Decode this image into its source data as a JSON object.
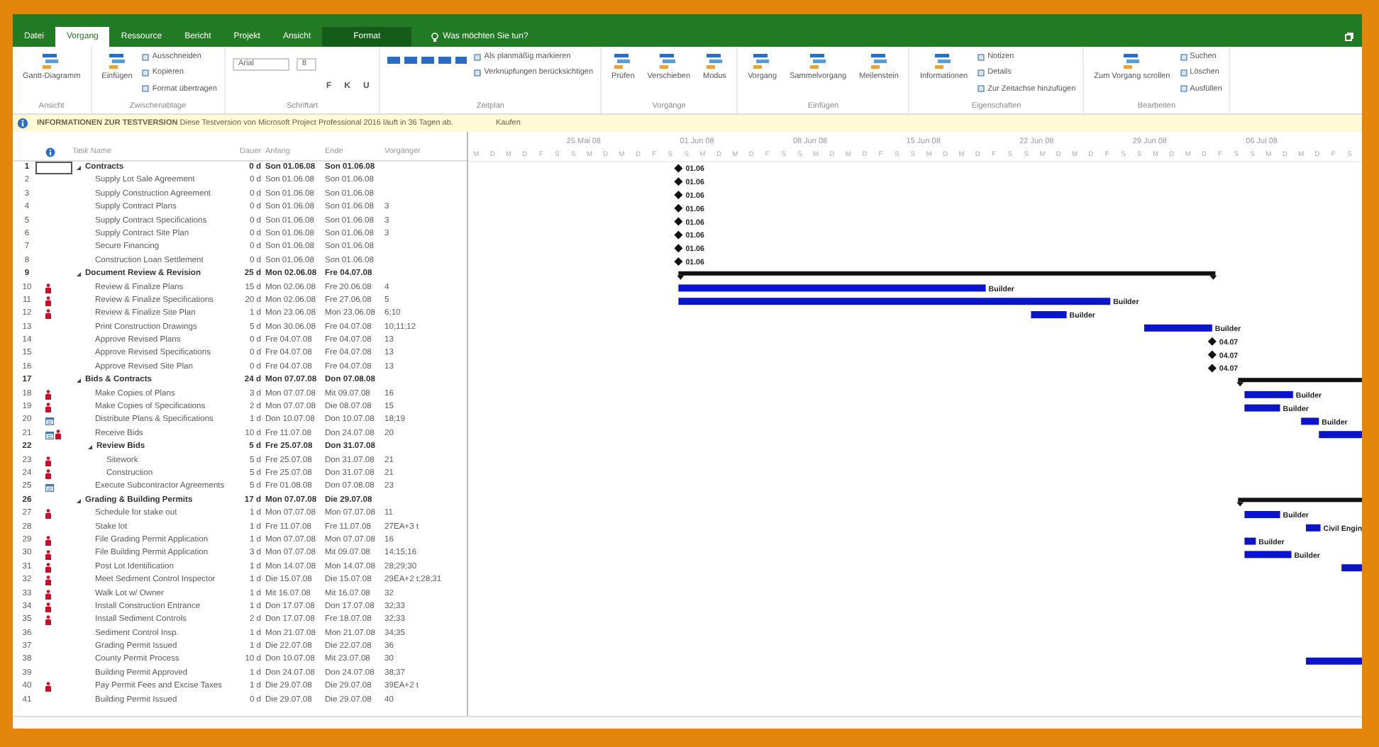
{
  "tabs": [
    {
      "label": "Datei",
      "kind": "tab",
      "selected": false
    },
    {
      "label": "Vorgang",
      "kind": "tab",
      "selected": true
    },
    {
      "label": "Ressource",
      "kind": "tab",
      "selected": false
    },
    {
      "label": "Bericht",
      "kind": "tab",
      "selected": false
    },
    {
      "label": "Projekt",
      "kind": "tab",
      "selected": false
    },
    {
      "label": "Ansicht",
      "kind": "tab",
      "selected": false
    },
    {
      "label": "Format",
      "kind": "contextual",
      "selected": false
    },
    {
      "label": "Was möchten Sie tun?",
      "kind": "search",
      "selected": false
    }
  ],
  "ribbon": {
    "groups": [
      {
        "label": "Ansicht",
        "items": [
          {
            "kind": "large",
            "label": "Gantt-Diagramm"
          }
        ]
      },
      {
        "label": "Zwischenablage",
        "items": [
          {
            "kind": "large",
            "label": "Einfügen"
          },
          {
            "kind": "small",
            "label": "Ausschneiden"
          },
          {
            "kind": "small",
            "label": "Kopieren"
          },
          {
            "kind": "small",
            "label": "Format übertragen"
          }
        ]
      },
      {
        "label": "Schriftart",
        "items": [
          {
            "kind": "combo",
            "value": "Arial"
          },
          {
            "kind": "combo",
            "value": "8"
          },
          {
            "kind": "toggle",
            "label": "F"
          },
          {
            "kind": "toggle",
            "label": "K"
          },
          {
            "kind": "toggle",
            "label": "U"
          }
        ]
      },
      {
        "label": "Zeitplan",
        "items": [
          {
            "kind": "percent"
          },
          {
            "kind": "small",
            "label": "Als planmäßig markieren"
          },
          {
            "kind": "small",
            "label": "Verknüpfungen berücksichtigen"
          }
        ]
      },
      {
        "label": "Vorgänge",
        "items": [
          {
            "kind": "large",
            "label": "Prüfen"
          },
          {
            "kind": "large",
            "label": "Verschieben"
          },
          {
            "kind": "large",
            "label": "Modus"
          }
        ]
      },
      {
        "label": "Einfügen",
        "items": [
          {
            "kind": "large",
            "label": "Vorgang"
          },
          {
            "kind": "large",
            "label": "Sammelvorgang"
          },
          {
            "kind": "large",
            "label": "Meilenstein"
          }
        ]
      },
      {
        "label": "Eigenschaften",
        "items": [
          {
            "kind": "large",
            "label": "Informationen"
          },
          {
            "kind": "small",
            "label": "Notizen"
          },
          {
            "kind": "small",
            "label": "Details"
          },
          {
            "kind": "small",
            "label": "Zur Zeitachse hinzufügen"
          }
        ]
      },
      {
        "label": "Bearbeiten",
        "items": [
          {
            "kind": "large",
            "label": "Zum Vorgang scrollen"
          },
          {
            "kind": "small",
            "label": "Suchen"
          },
          {
            "kind": "small",
            "label": "Löschen"
          },
          {
            "kind": "small",
            "label": "Ausfüllen"
          }
        ]
      }
    ]
  },
  "info": {
    "title": "INFORMATIONEN ZUR TESTVERSION",
    "message": "Diese Testversion von Microsoft Project Professional 2016 läuft in 36 Tagen ab.",
    "button": "Kaufen"
  },
  "columns": [
    "Task Name",
    "Dauer",
    "Anfang",
    "Ende",
    "Vorgänger"
  ],
  "timescale": {
    "weeks": [
      "25 Mai 08",
      "01 Jun 08",
      "08 Jun 08",
      "15 Jun 08",
      "22 Jun 08",
      "29 Jun 08",
      "06 Jul 08"
    ],
    "days": [
      "M",
      "D",
      "M",
      "D",
      "F",
      "S",
      "S",
      "M",
      "D",
      "M",
      "D",
      "F",
      "S",
      "S",
      "M",
      "D",
      "M",
      "D",
      "F",
      "S",
      "S",
      "M",
      "D",
      "M",
      "D",
      "F",
      "S",
      "S",
      "M",
      "D",
      "M",
      "D",
      "F",
      "S",
      "S",
      "M",
      "D",
      "M",
      "D",
      "F",
      "S",
      "S",
      "M",
      "D",
      "M",
      "D",
      "F",
      "S",
      "S",
      "M",
      "D",
      "M",
      "D",
      "F",
      "S"
    ]
  },
  "tasks": [
    {
      "id": "1",
      "name": "Contracts",
      "duration": "0 d",
      "start": "Son 01.06.08",
      "finish": "Son 01.06.08",
      "selected": true,
      "expanded": true,
      "bar_label": "01.06",
      "children": [
        {
          "id": "2",
          "name": "Supply Lot Sale Agreement",
          "duration": "0 d",
          "start": "Son 01.06.08",
          "finish": "Son 01.06.08",
          "selected": false,
          "bar_label": "01.06"
        },
        {
          "id": "3",
          "name": "Supply Construction Agreement",
          "duration": "0 d",
          "start": "Son 01.06.08",
          "finish": "Son 01.06.08",
          "selected": false,
          "bar_label": "01.06"
        },
        {
          "id": "4",
          "name": "Supply Contract Plans",
          "duration": "0 d",
          "start": "Son 01.06.08",
          "finish": "Son 01.06.08",
          "predecessors": "3",
          "selected": false,
          "bar_label": "01.06"
        },
        {
          "id": "5",
          "name": "Supply Contract Specifications",
          "duration": "0 d",
          "start": "Son 01.06.08",
          "finish": "Son 01.06.08",
          "predecessors": "3",
          "selected": false,
          "bar_label": "01.06"
        },
        {
          "id": "6",
          "name": "Supply Contract Site Plan",
          "duration": "0 d",
          "start": "Son 01.06.08",
          "finish": "Son 01.06.08",
          "predecessors": "3",
          "selected": false,
          "bar_label": "01.06"
        },
        {
          "id": "7",
          "name": "Secure Financing",
          "duration": "0 d",
          "start": "Son 01.06.08",
          "finish": "Son 01.06.08",
          "selected": false,
          "bar_label": "01.06"
        },
        {
          "id": "8",
          "name": "Construction Loan Settlement",
          "duration": "0 d",
          "start": "Son 01.06.08",
          "finish": "Son 01.06.08",
          "selected": false,
          "bar_label": "01.06"
        }
      ]
    },
    {
      "id": "9",
      "name": "Document Review & Revision",
      "duration": "25 d",
      "start": "Mon 02.06.08",
      "finish": "Fre 04.07.08",
      "selected": false,
      "expanded": true,
      "children": [
        {
          "id": "10",
          "name": "Review & Finalize Plans",
          "duration": "15 d",
          "start": "Mon 02.06.08",
          "finish": "Fre 20.06.08",
          "predecessors": "4",
          "resource": true,
          "selected": false,
          "bar_label": "Builder"
        },
        {
          "id": "11",
          "name": "Review & Finalize Specifications",
          "duration": "20 d",
          "start": "Mon 02.06.08",
          "finish": "Fre 27.06.08",
          "predecessors": "5",
          "resource": true,
          "selected": false,
          "bar_label": "Builder"
        },
        {
          "id": "12",
          "name": "Review & Finalize Site Plan",
          "duration": "1 d",
          "start": "Mon 23.06.08",
          "finish": "Mon 23.06.08",
          "predecessors": "6;10",
          "resource": true,
          "selected": false,
          "bar_label": "Builder"
        },
        {
          "id": "13",
          "name": "Print Construction Drawings",
          "duration": "5 d",
          "start": "Mon 30.06.08",
          "finish": "Fre 04.07.08",
          "predecessors": "10;11;12",
          "selected": false,
          "bar_label": "Builder"
        },
        {
          "id": "14",
          "name": "Approve Revised Plans",
          "duration": "0 d",
          "start": "Fre 04.07.08",
          "finish": "Fre 04.07.08",
          "predecessors": "13",
          "selected": false,
          "bar_label": "04.07"
        },
        {
          "id": "15",
          "name": "Approve Revised Specifications",
          "duration": "0 d",
          "start": "Fre 04.07.08",
          "finish": "Fre 04.07.08",
          "predecessors": "13",
          "selected": false,
          "bar_label": "04.07"
        },
        {
          "id": "16",
          "name": "Approve Revised Site Plan",
          "duration": "0 d",
          "start": "Fre 04.07.08",
          "finish": "Fre 04.07.08",
          "predecessors": "13",
          "selected": false,
          "bar_label": "04.07"
        }
      ]
    },
    {
      "id": "17",
      "name": "Bids & Contracts",
      "duration": "24 d",
      "start": "Mon 07.07.08",
      "finish": "Don 07.08.08",
      "selected": false,
      "expanded": true,
      "children": [
        {
          "id": "18",
          "name": "Make Copies of Plans",
          "duration": "3 d",
          "start": "Mon 07.07.08",
          "finish": "Mit 09.07.08",
          "predecessors": "16",
          "resource": true,
          "selected": false,
          "bar_label": "Builder"
        },
        {
          "id": "19",
          "name": "Make Copies of Specifications",
          "duration": "2 d",
          "start": "Mon 07.07.08",
          "finish": "Die 08.07.08",
          "predecessors": "15",
          "resource": true,
          "selected": false,
          "bar_label": "Builder"
        },
        {
          "id": "20",
          "name": "Distribute Plans & Specifications",
          "duration": "1 d",
          "start": "Don 10.07.08",
          "finish": "Don 10.07.08",
          "predecessors": "18;19",
          "calendar": true,
          "selected": false,
          "bar_label": "Builder"
        },
        {
          "id": "21",
          "name": "Receive Bids",
          "duration": "10 d",
          "start": "Fre 11.07.08",
          "finish": "Don 24.07.08",
          "predecessors": "20",
          "calendar": true,
          "resource": true,
          "selected": false
        },
        {
          "id": "22",
          "name": "Review Bids",
          "duration": "5 d",
          "start": "Fre 25.07.08",
          "finish": "Don 31.07.08",
          "selected": false,
          "expanded": true,
          "children": [
            {
              "id": "23",
              "name": "Sitework",
              "duration": "5 d",
              "start": "Fre 25.07.08",
              "finish": "Don 31.07.08",
              "predecessors": "21",
              "resource": true,
              "selected": false
            },
            {
              "id": "24",
              "name": "Construction",
              "duration": "5 d",
              "start": "Fre 25.07.08",
              "finish": "Don 31.07.08",
              "predecessors": "21",
              "resource": true,
              "selected": false
            }
          ]
        },
        {
          "id": "25",
          "name": "Execute Subcontractor Agreements",
          "duration": "5 d",
          "start": "Fre 01.08.08",
          "finish": "Don 07.08.08",
          "predecessors": "23",
          "calendar": true,
          "selected": false
        }
      ]
    },
    {
      "id": "26",
      "name": "Grading & Building Permits",
      "duration": "17 d",
      "start": "Mon 07.07.08",
      "finish": "Die 29.07.08",
      "selected": false,
      "expanded": true,
      "children": [
        {
          "id": "27",
          "name": "Schedule for stake out",
          "duration": "1 d",
          "start": "Mon 07.07.08",
          "finish": "Mon 07.07.08",
          "predecessors": "11",
          "resource": true,
          "selected": false,
          "bar_label": "Builder"
        },
        {
          "id": "28",
          "name": "Stake lot",
          "duration": "1 d",
          "start": "Fre 11.07.08",
          "finish": "Fre 11.07.08",
          "predecessors": "27EA+3 t",
          "selected": false,
          "bar_label": "Civil Engin"
        },
        {
          "id": "29",
          "name": "File Grading Permit Application",
          "duration": "1 d",
          "start": "Mon 07.07.08",
          "finish": "Mon 07.07.08",
          "predecessors": "16",
          "resource": true,
          "selected": false,
          "bar_label": "Builder"
        },
        {
          "id": "30",
          "name": "File Building Permit Application",
          "duration": "3 d",
          "start": "Mon 07.07.08",
          "finish": "Mit 09.07.08",
          "predecessors": "14;15;16",
          "resource": true,
          "selected": false,
          "bar_label": "Builder"
        },
        {
          "id": "31",
          "name": "Post Lot Identification",
          "duration": "1 d",
          "start": "Mon 14.07.08",
          "finish": "Mon 14.07.08",
          "predecessors": "28;29;30",
          "resource": true,
          "selected": false
        },
        {
          "id": "32",
          "name": "Meet Sediment Control Inspector",
          "duration": "1 d",
          "start": "Die 15.07.08",
          "finish": "Die 15.07.08",
          "predecessors": "29EA+2 t;28;31",
          "resource": true,
          "selected": false
        },
        {
          "id": "33",
          "name": "Walk Lot w/ Owner",
          "duration": "1 d",
          "start": "Mit 16.07.08",
          "finish": "Mit 16.07.08",
          "predecessors": "32",
          "resource": true,
          "selected": false
        },
        {
          "id": "34",
          "name": "Install Construction Entrance",
          "duration": "1 d",
          "start": "Don 17.07.08",
          "finish": "Don 17.07.08",
          "predecessors": "32;33",
          "resource": true,
          "selected": false
        },
        {
          "id": "35",
          "name": "Install Sediment Controls",
          "duration": "2 d",
          "start": "Don 17.07.08",
          "finish": "Fre 18.07.08",
          "predecessors": "32;33",
          "resource": true,
          "selected": false
        },
        {
          "id": "36",
          "name": "Sediment Control Insp.",
          "duration": "1 d",
          "start": "Mon 21.07.08",
          "finish": "Mon 21.07.08",
          "predecessors": "34;35",
          "selected": false
        },
        {
          "id": "37",
          "name": "Grading Permit Issued",
          "duration": "1 d",
          "start": "Die 22.07.08",
          "finish": "Die 22.07.08",
          "predecessors": "36",
          "selected": false
        },
        {
          "id": "38",
          "name": "County Permit Process",
          "duration": "10 d",
          "start": "Don 10.07.08",
          "finish": "Mit 23.07.08",
          "predecessors": "30",
          "selected": false
        },
        {
          "id": "39",
          "name": "Building Permit Approved",
          "duration": "1 d",
          "start": "Don 24.07.08",
          "finish": "Don 24.07.08",
          "predecessors": "38;37",
          "selected": false
        },
        {
          "id": "40",
          "name": "Pay Permit Fees and Excise Taxes",
          "duration": "1 d",
          "start": "Die 29.07.08",
          "finish": "Die 29.07.08",
          "predecessors": "39EA+2 t",
          "resource": true,
          "selected": false
        },
        {
          "id": "41",
          "name": "Building Permit Issued",
          "duration": "0 d",
          "start": "Die 29.07.08",
          "finish": "Die 29.07.08",
          "predecessors": "40",
          "selected": false
        }
      ]
    }
  ]
}
